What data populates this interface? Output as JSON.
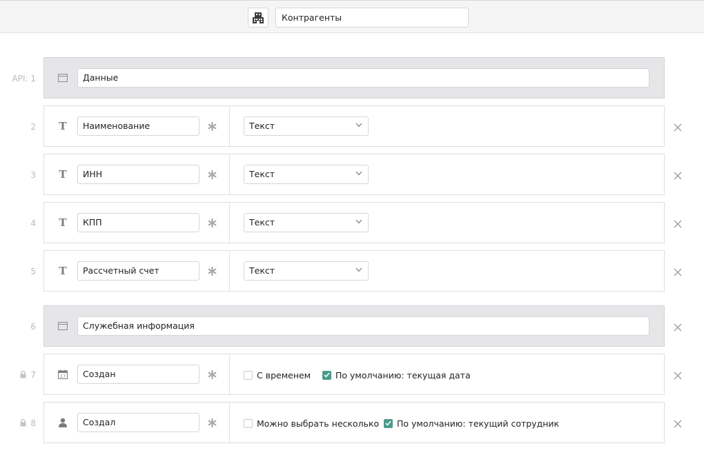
{
  "header": {
    "entity_icon": "building-icon",
    "entity_name": "Контрагенты"
  },
  "rows": [
    {
      "num": "API: 1",
      "type": "section",
      "icon": "window-icon",
      "value": "Данные"
    },
    {
      "num": "2",
      "type": "text-field",
      "icon": "text-type-icon",
      "value": "Наименование",
      "field_type": "Текст"
    },
    {
      "num": "3",
      "type": "text-field",
      "icon": "text-type-icon",
      "value": "ИНН",
      "field_type": "Текст"
    },
    {
      "num": "4",
      "type": "text-field",
      "icon": "text-type-icon",
      "value": "КПП",
      "field_type": "Текст"
    },
    {
      "num": "5",
      "type": "text-field",
      "icon": "text-type-icon",
      "value": "Рассчетный счет",
      "field_type": "Текст"
    },
    {
      "num": "6",
      "type": "section",
      "icon": "window-icon",
      "value": "Служебная информация"
    },
    {
      "num": "7",
      "type": "date-field",
      "icon": "calendar-icon",
      "locked": true,
      "value": "Создан",
      "options": [
        {
          "label": "С временем",
          "checked": false
        },
        {
          "label": "По умолчанию: текущая дата",
          "checked": true
        }
      ]
    },
    {
      "num": "8",
      "type": "user-field",
      "icon": "user-icon",
      "locked": true,
      "value": "Создал",
      "options": [
        {
          "label": "Можно выбрать несколько",
          "checked": false
        },
        {
          "label": "По умолчанию: текущий сотрудник",
          "checked": true
        }
      ]
    }
  ],
  "colors": {
    "accent": "#4c9a8a",
    "section_bg": "#e6e6e9",
    "muted": "#b9b9bd"
  }
}
